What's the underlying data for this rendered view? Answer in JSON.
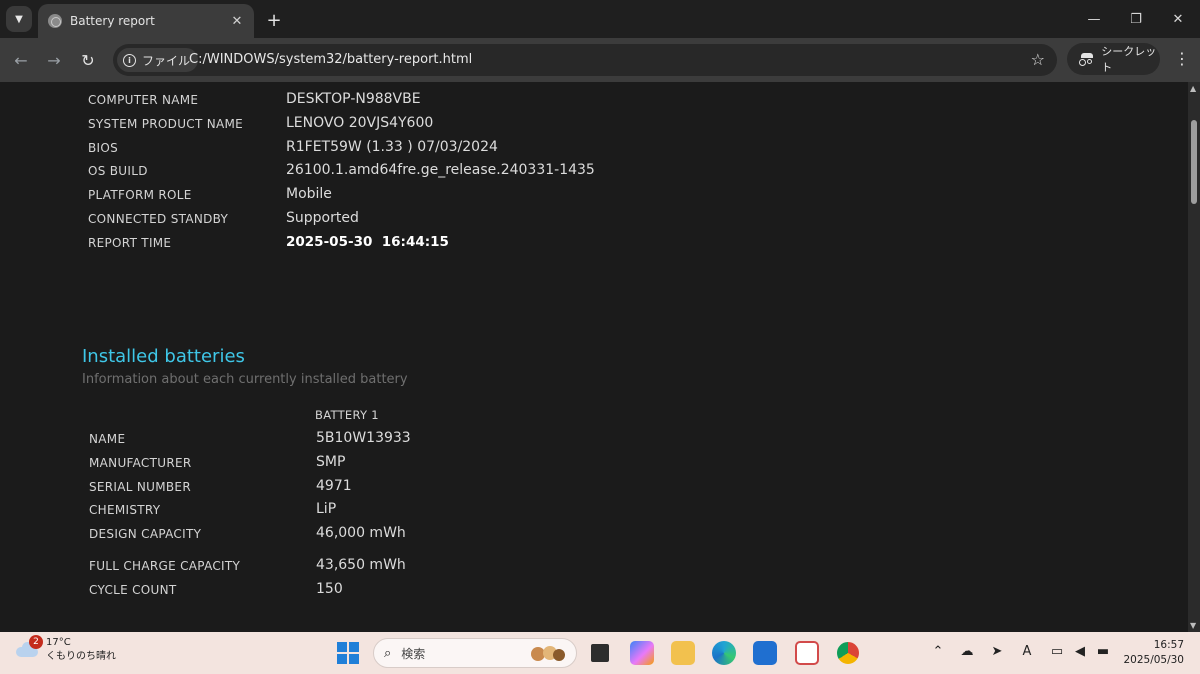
{
  "browser": {
    "tab_title": "Battery report",
    "omnibox_chip": "ファイル",
    "url": "C:/WINDOWS/system32/battery-report.html",
    "incognito_label": "シークレット",
    "icons": [
      "tab-list-icon",
      "favicon-globe-icon",
      "close-icon",
      "plus-icon",
      "minimize-icon",
      "restore-icon",
      "close-window-icon",
      "back-arrow-icon",
      "forward-arrow-icon",
      "reload-icon",
      "info-icon",
      "star-icon",
      "incognito-icon",
      "kebab-menu-icon"
    ]
  },
  "system_info": [
    {
      "label": "COMPUTER NAME",
      "value": "DESKTOP-N988VBE"
    },
    {
      "label": "SYSTEM PRODUCT NAME",
      "value": "LENOVO 20VJS4Y600"
    },
    {
      "label": "BIOS",
      "value": "R1FET59W (1.33 ) 07/03/2024"
    },
    {
      "label": "OS BUILD",
      "value": "26100.1.amd64fre.ge_release.240331-1435"
    },
    {
      "label": "PLATFORM ROLE",
      "value": "Mobile"
    },
    {
      "label": "CONNECTED STANDBY",
      "value": "Supported"
    },
    {
      "label": "REPORT TIME",
      "value": "2025-05-30  16:44:15"
    }
  ],
  "installed_batteries": {
    "title": "Installed batteries",
    "subtitle": "Information about each currently installed battery",
    "column_header": "BATTERY 1",
    "rows": [
      {
        "label": "NAME",
        "value": "5B10W13933"
      },
      {
        "label": "MANUFACTURER",
        "value": "SMP"
      },
      {
        "label": "SERIAL NUMBER",
        "value": "4971"
      },
      {
        "label": "CHEMISTRY",
        "value": "LiP"
      },
      {
        "label": "DESIGN CAPACITY",
        "value": "46,000 mWh"
      },
      {
        "label": "FULL CHARGE CAPACITY",
        "value": "43,650 mWh"
      },
      {
        "label": "CYCLE COUNT",
        "value": "150"
      }
    ]
  },
  "taskbar": {
    "weather_badge": "2",
    "weather_temp": "17°C",
    "weather_desc": "くもりのち晴れ",
    "search_placeholder": "検索",
    "tray_ime": "A",
    "clock_time": "16:57",
    "clock_date": "2025/05/30"
  },
  "colors": {
    "page_bg": "#1b1b1b",
    "section_title": "#3fc7e8",
    "taskbar_bg": "#f3e4df"
  }
}
